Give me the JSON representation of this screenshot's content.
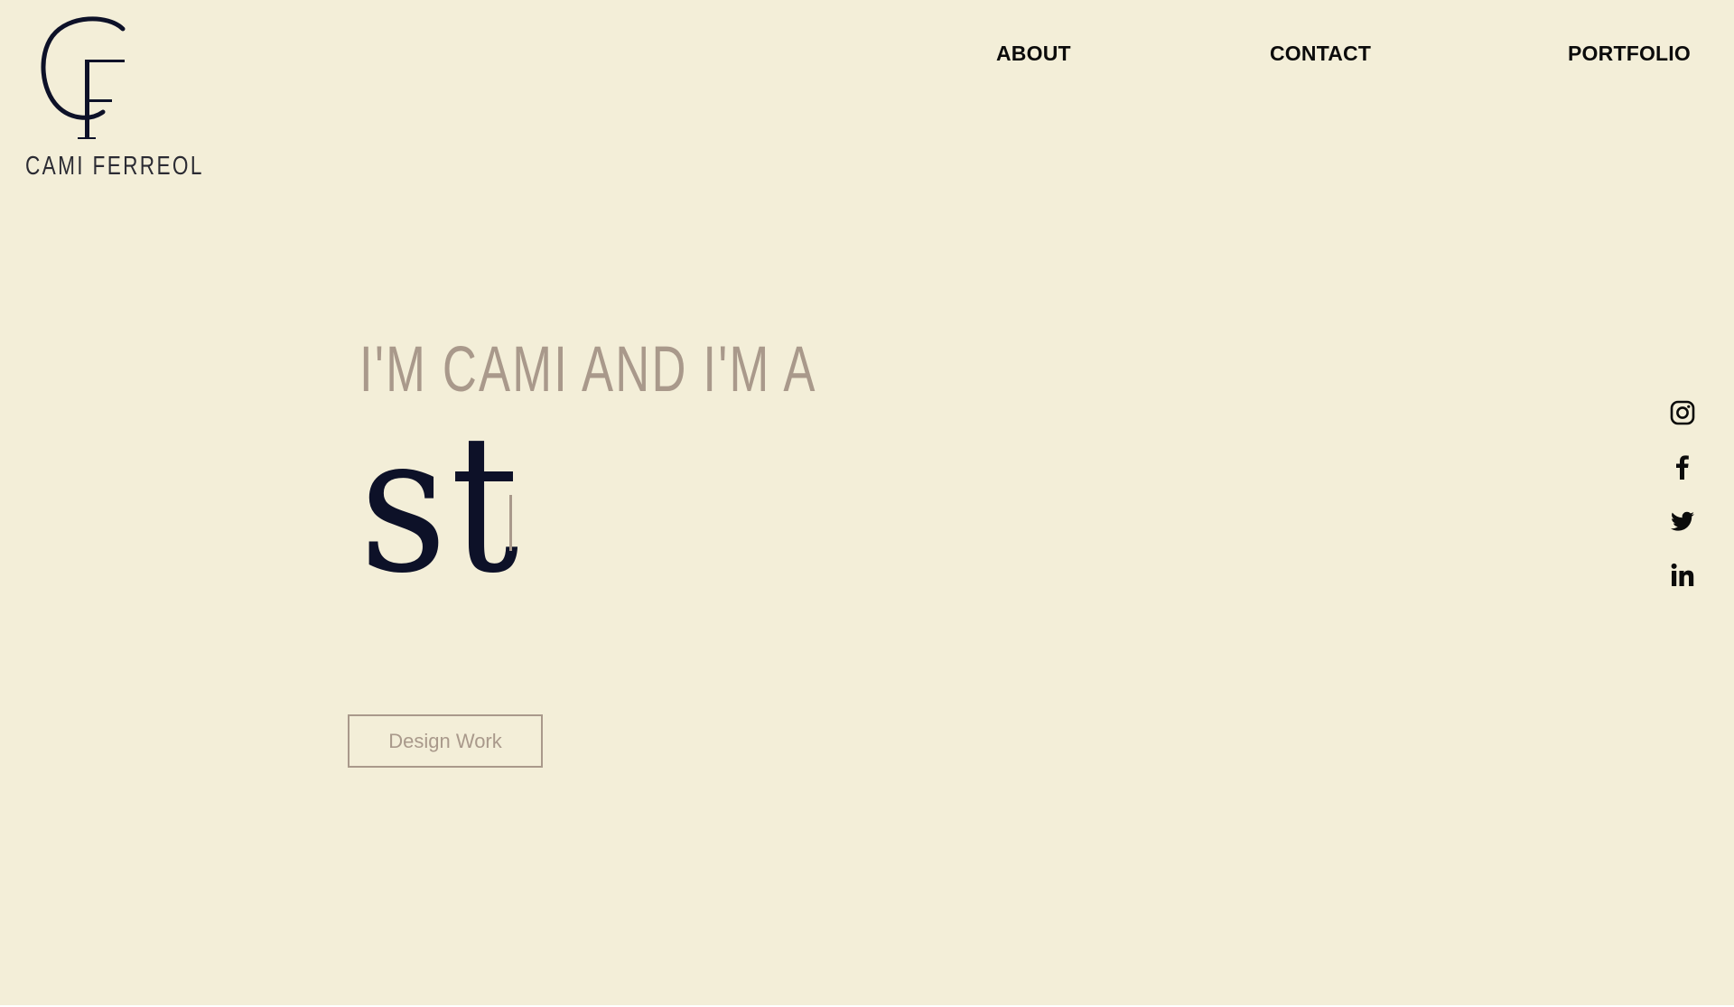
{
  "brand": {
    "monogram": "CF",
    "name": "CAMI FERREOL"
  },
  "nav": {
    "items": [
      {
        "label": "ABOUT"
      },
      {
        "label": "CONTACT"
      },
      {
        "label": "PORTFOLIO"
      }
    ]
  },
  "hero": {
    "intro": "I'M CAMI AND I'M A",
    "typed_text": "st",
    "cta_label": "Design Work"
  },
  "social": {
    "icons": [
      "instagram-icon",
      "facebook-icon",
      "twitter-icon",
      "linkedin-icon"
    ]
  },
  "colors": {
    "background": "#f3eed8",
    "accent": "#a9998b",
    "ink": "#0d1128",
    "nav": "#0b0b0b"
  }
}
